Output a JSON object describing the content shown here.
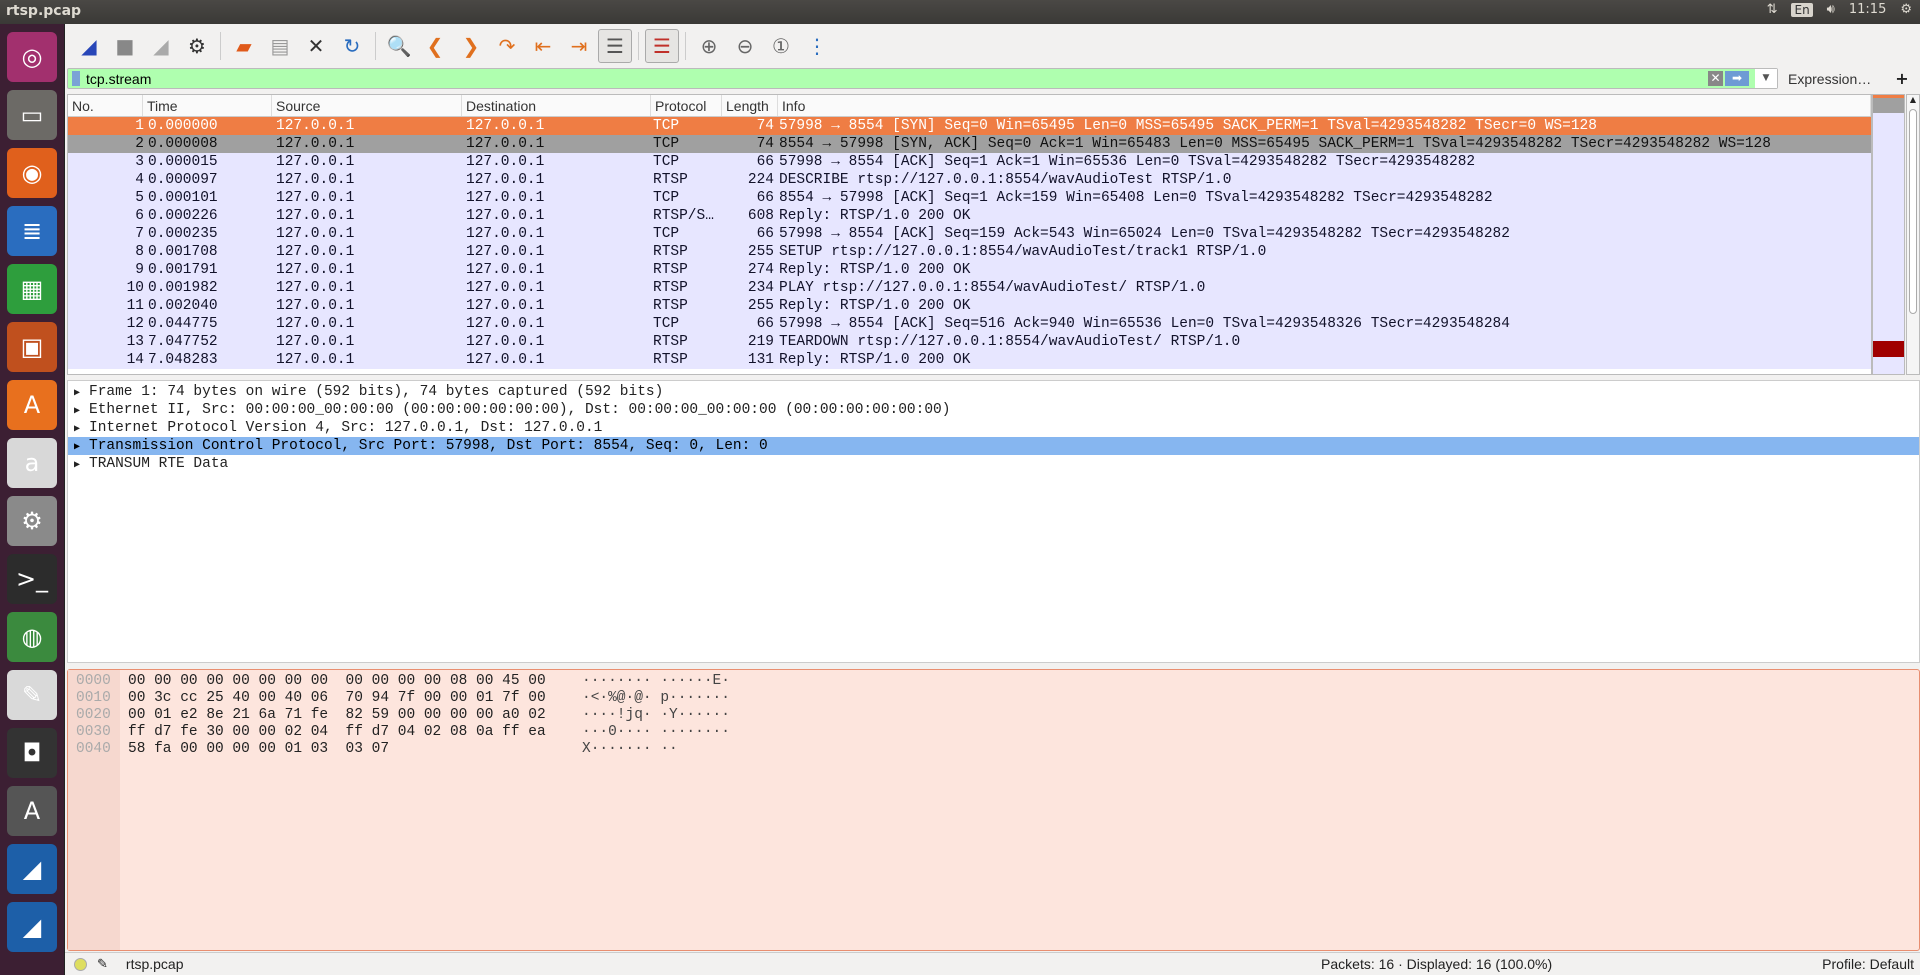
{
  "window": {
    "title": "rtsp.pcap"
  },
  "tray": {
    "lang": "En",
    "clock": "11:15"
  },
  "launcher": [
    {
      "name": "ubuntu-dash",
      "color": "#a2306e",
      "glyph": "◎"
    },
    {
      "name": "files",
      "color": "#6c6a66",
      "glyph": "▭"
    },
    {
      "name": "firefox",
      "color": "#e0601c",
      "glyph": "◉"
    },
    {
      "name": "writer",
      "color": "#2a6dbf",
      "glyph": "≣"
    },
    {
      "name": "calc",
      "color": "#2e9e3d",
      "glyph": "▦"
    },
    {
      "name": "impress",
      "color": "#c0501e",
      "glyph": "▣"
    },
    {
      "name": "software-center",
      "color": "#e8701e",
      "glyph": "A"
    },
    {
      "name": "amazon",
      "color": "#d8d8d8",
      "glyph": "a"
    },
    {
      "name": "settings",
      "color": "#8a8a8a",
      "glyph": "⚙"
    },
    {
      "name": "terminal",
      "color": "#2c2c2c",
      "glyph": ">_"
    },
    {
      "name": "chrome",
      "color": "#3b8a3e",
      "glyph": "◍"
    },
    {
      "name": "text-editor",
      "color": "#d9d9d9",
      "glyph": "✎"
    },
    {
      "name": "disk",
      "color": "#333333",
      "glyph": "◘"
    },
    {
      "name": "updater",
      "color": "#555555",
      "glyph": "A"
    },
    {
      "name": "wireshark",
      "color": "#1d5fa8",
      "glyph": "◢"
    },
    {
      "name": "wireshark-2",
      "color": "#1d5fa8",
      "glyph": "◢"
    }
  ],
  "toolbar": [
    {
      "name": "start-capture",
      "glyph": "◢",
      "color": "#2846b8"
    },
    {
      "name": "stop-capture",
      "glyph": "■",
      "color": "#888"
    },
    {
      "name": "restart-capture",
      "glyph": "◢",
      "color": "#aaa"
    },
    {
      "name": "capture-options",
      "glyph": "⚙",
      "color": "#333"
    },
    {
      "sep": true
    },
    {
      "name": "open-file",
      "glyph": "▰",
      "color": "#e05a1a"
    },
    {
      "name": "save-file",
      "glyph": "▤",
      "color": "#999"
    },
    {
      "name": "close-file",
      "glyph": "✕",
      "color": "#333"
    },
    {
      "name": "reload-file",
      "glyph": "↻",
      "color": "#2a6dbf"
    },
    {
      "sep": true
    },
    {
      "name": "find-packet",
      "glyph": "🔍",
      "color": "#2846b8"
    },
    {
      "name": "go-back",
      "glyph": "❮",
      "color": "#e0701e"
    },
    {
      "name": "go-forward",
      "glyph": "❯",
      "color": "#e0701e"
    },
    {
      "name": "go-to-packet",
      "glyph": "↷",
      "color": "#e0701e"
    },
    {
      "name": "first-packet",
      "glyph": "⇤",
      "color": "#e0701e"
    },
    {
      "name": "last-packet",
      "glyph": "⇥",
      "color": "#e0701e"
    },
    {
      "name": "autoscroll",
      "glyph": "☰",
      "color": "#555",
      "on": true
    },
    {
      "sep": true
    },
    {
      "name": "colorize",
      "glyph": "☰",
      "color": "#c0302a",
      "on": true
    },
    {
      "sep": true
    },
    {
      "name": "zoom-in",
      "glyph": "⊕",
      "color": "#666"
    },
    {
      "name": "zoom-out",
      "glyph": "⊖",
      "color": "#666"
    },
    {
      "name": "normal-size",
      "glyph": "①",
      "color": "#666"
    },
    {
      "name": "resize-columns",
      "glyph": "⋮",
      "color": "#2a6dbf"
    }
  ],
  "filter": {
    "value": "tcp.stream",
    "expression_label": "Expression…",
    "add_label": "+"
  },
  "columns": [
    "No.",
    "Time",
    "Source",
    "Destination",
    "Protocol",
    "Length",
    "Info"
  ],
  "packets": [
    {
      "no": "1",
      "time": "0.000000",
      "src": "127.0.0.1",
      "dst": "127.0.0.1",
      "proto": "TCP",
      "len": "74",
      "info": "57998 → 8554 [SYN] Seq=0 Win=65495 Len=0 MSS=65495 SACK_PERM=1 TSval=4293548282 TSecr=0 WS=128",
      "state": "sel"
    },
    {
      "no": "2",
      "time": "0.000008",
      "src": "127.0.0.1",
      "dst": "127.0.0.1",
      "proto": "TCP",
      "len": "74",
      "info": "8554 → 57998 [SYN, ACK] Seq=0 Ack=1 Win=65483 Len=0 MSS=65495 SACK_PERM=1 TSval=4293548282 TSecr=4293548282 WS=128",
      "state": "rel"
    },
    {
      "no": "3",
      "time": "0.000015",
      "src": "127.0.0.1",
      "dst": "127.0.0.1",
      "proto": "TCP",
      "len": "66",
      "info": "57998 → 8554 [ACK] Seq=1 Ack=1 Win=65536 Len=0 TSval=4293548282 TSecr=4293548282"
    },
    {
      "no": "4",
      "time": "0.000097",
      "src": "127.0.0.1",
      "dst": "127.0.0.1",
      "proto": "RTSP",
      "len": "224",
      "info": "DESCRIBE rtsp://127.0.0.1:8554/wavAudioTest RTSP/1.0"
    },
    {
      "no": "5",
      "time": "0.000101",
      "src": "127.0.0.1",
      "dst": "127.0.0.1",
      "proto": "TCP",
      "len": "66",
      "info": "8554 → 57998 [ACK] Seq=1 Ack=159 Win=65408 Len=0 TSval=4293548282 TSecr=4293548282"
    },
    {
      "no": "6",
      "time": "0.000226",
      "src": "127.0.0.1",
      "dst": "127.0.0.1",
      "proto": "RTSP/S…",
      "len": "608",
      "info": "Reply: RTSP/1.0 200 OK"
    },
    {
      "no": "7",
      "time": "0.000235",
      "src": "127.0.0.1",
      "dst": "127.0.0.1",
      "proto": "TCP",
      "len": "66",
      "info": "57998 → 8554 [ACK] Seq=159 Ack=543 Win=65024 Len=0 TSval=4293548282 TSecr=4293548282"
    },
    {
      "no": "8",
      "time": "0.001708",
      "src": "127.0.0.1",
      "dst": "127.0.0.1",
      "proto": "RTSP",
      "len": "255",
      "info": "SETUP rtsp://127.0.0.1:8554/wavAudioTest/track1 RTSP/1.0"
    },
    {
      "no": "9",
      "time": "0.001791",
      "src": "127.0.0.1",
      "dst": "127.0.0.1",
      "proto": "RTSP",
      "len": "274",
      "info": "Reply: RTSP/1.0 200 OK"
    },
    {
      "no": "10",
      "time": "0.001982",
      "src": "127.0.0.1",
      "dst": "127.0.0.1",
      "proto": "RTSP",
      "len": "234",
      "info": "PLAY rtsp://127.0.0.1:8554/wavAudioTest/ RTSP/1.0"
    },
    {
      "no": "11",
      "time": "0.002040",
      "src": "127.0.0.1",
      "dst": "127.0.0.1",
      "proto": "RTSP",
      "len": "255",
      "info": "Reply: RTSP/1.0 200 OK"
    },
    {
      "no": "12",
      "time": "0.044775",
      "src": "127.0.0.1",
      "dst": "127.0.0.1",
      "proto": "TCP",
      "len": "66",
      "info": "57998 → 8554 [ACK] Seq=516 Ack=940 Win=65536 Len=0 TSval=4293548326 TSecr=4293548284"
    },
    {
      "no": "13",
      "time": "7.047752",
      "src": "127.0.0.1",
      "dst": "127.0.0.1",
      "proto": "RTSP",
      "len": "219",
      "info": "TEARDOWN rtsp://127.0.0.1:8554/wavAudioTest/ RTSP/1.0"
    },
    {
      "no": "14",
      "time": "7.048283",
      "src": "127.0.0.1",
      "dst": "127.0.0.1",
      "proto": "RTSP",
      "len": "131",
      "info": "Reply: RTSP/1.0 200 OK"
    }
  ],
  "details": [
    {
      "text": "Frame 1: 74 bytes on wire (592 bits), 74 bytes captured (592 bits)"
    },
    {
      "text": "Ethernet II, Src: 00:00:00_00:00:00 (00:00:00:00:00:00), Dst: 00:00:00_00:00:00 (00:00:00:00:00:00)"
    },
    {
      "text": "Internet Protocol Version 4, Src: 127.0.0.1, Dst: 127.0.0.1"
    },
    {
      "text": "Transmission Control Protocol, Src Port: 57998, Dst Port: 8554, Seq: 0, Len: 0",
      "selected": true
    },
    {
      "text": "TRANSUM RTE Data"
    }
  ],
  "hex": [
    {
      "offset": "0000",
      "bytes": "00 00 00 00 00 00 00 00  00 00 00 00 08 00 45 00",
      "ascii": "········ ······E·"
    },
    {
      "offset": "0010",
      "bytes": "00 3c cc 25 40 00 40 06  70 94 7f 00 00 01 7f 00",
      "ascii": "·<·%@·@· p·······"
    },
    {
      "offset": "0020",
      "bytes": "00 01 e2 8e 21 6a 71 fe  82 59 00 00 00 00 a0 02",
      "ascii": "····!jq· ·Y······"
    },
    {
      "offset": "0030",
      "bytes": "ff d7 fe 30 00 00 02 04  ff d7 04 02 08 0a ff ea",
      "ascii": "···0···· ········"
    },
    {
      "offset": "0040",
      "bytes": "58 fa 00 00 00 00 01 03  03 07",
      "ascii": "X······· ··"
    }
  ],
  "status": {
    "file": "rtsp.pcap",
    "packets": "Packets: 16 · Displayed: 16 (100.0%)",
    "profile": "Profile: Default"
  }
}
